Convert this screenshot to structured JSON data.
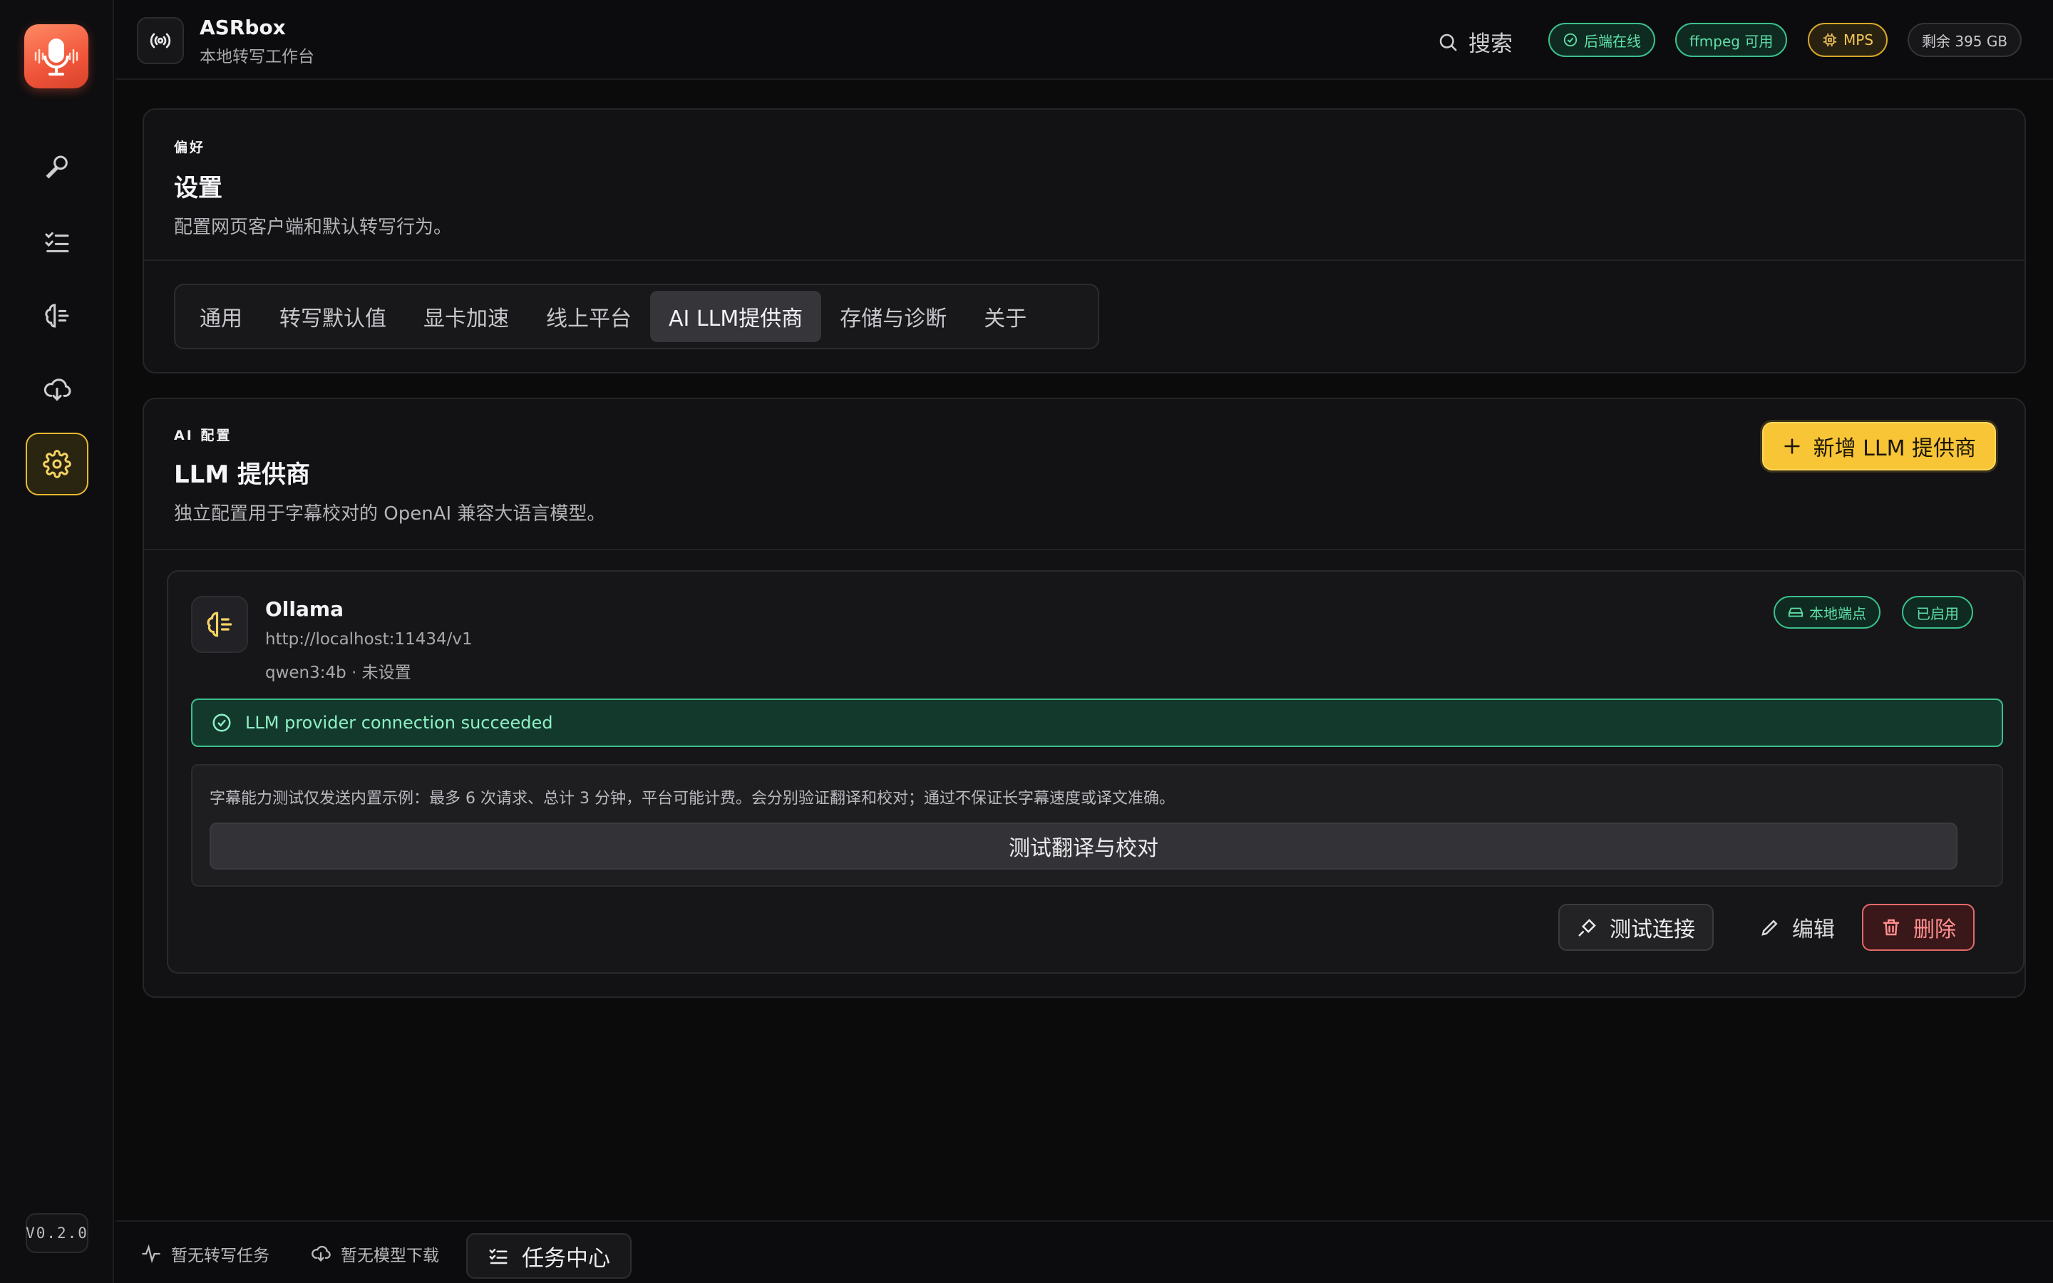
{
  "app": {
    "title": "ASRbox",
    "subtitle": "本地转写工作台",
    "version": "V0.2.0"
  },
  "icons": {
    "logo": "microphone-waveform-icon",
    "nav": [
      "microphone-icon",
      "task-list-icon",
      "brain-icon",
      "cloud-download-icon",
      "gear-icon"
    ]
  },
  "header": {
    "search_label": "搜索",
    "badges": {
      "backend": "后端在线",
      "ffmpeg": "ffmpeg 可用",
      "mps": "MPS",
      "disk": "剩余 395 GB"
    }
  },
  "settings": {
    "eyebrow": "偏好",
    "title": "设置",
    "desc": "配置网页客户端和默认转写行为。",
    "tabs": [
      "通用",
      "转写默认值",
      "显卡加速",
      "线上平台",
      "AI LLM提供商",
      "存储与诊断",
      "关于"
    ],
    "active_tab": "AI LLM提供商"
  },
  "llm": {
    "eyebrow": "AI 配置",
    "title": "LLM 提供商",
    "desc": "独立配置用于字幕校对的 OpenAI 兼容大语言模型。",
    "add_label": "新增 LLM 提供商",
    "provider": {
      "name": "Ollama",
      "url": "http://localhost:11434/v1",
      "model": "qwen3:4b · 未设置",
      "tag_local": "本地端点",
      "tag_enabled": "已启用",
      "success_msg": "LLM provider connection succeeded",
      "test_note": "字幕能力测试仅发送内置示例：最多 6 次请求、总计 3 分钟，平台可能计费。会分别验证翻译和校对；通过不保证长字幕速度或译文准确。",
      "test_btn": "测试翻译与校对",
      "test_conn": "测试连接",
      "edit": "编辑",
      "delete": "删除"
    }
  },
  "footer": {
    "transcribe": "暂无转写任务",
    "download": "暂无模型下载",
    "task_center": "任务中心"
  },
  "colors": {
    "accent": "#f7c536",
    "success": "#3bbf8c",
    "danger": "#e56a6a",
    "logo": "#f0553a"
  }
}
